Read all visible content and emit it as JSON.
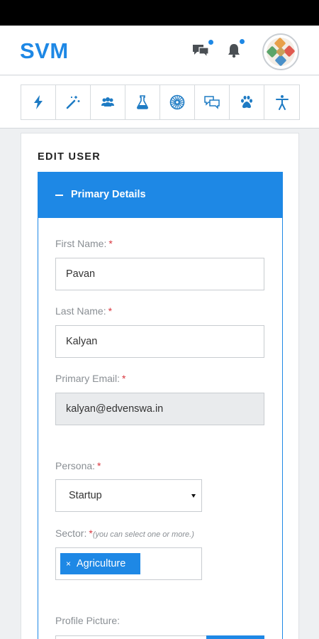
{
  "header": {
    "logo": "SVM"
  },
  "toolbar": {
    "tools": [
      {
        "icon": "lightning-icon"
      },
      {
        "icon": "magic-wand-icon"
      },
      {
        "icon": "users-icon"
      },
      {
        "icon": "flask-icon"
      },
      {
        "icon": "sunburst-icon"
      },
      {
        "icon": "chat-bubbles-icon"
      },
      {
        "icon": "paw-icon"
      },
      {
        "icon": "accessibility-icon"
      }
    ]
  },
  "card": {
    "title": "EDIT USER"
  },
  "panel": {
    "title": "Primary Details"
  },
  "form": {
    "first_name": {
      "label": "First Name:",
      "required": "*",
      "value": "Pavan"
    },
    "last_name": {
      "label": "Last Name:",
      "required": "*",
      "value": "Kalyan"
    },
    "email": {
      "label": "Primary Email:",
      "required": "*",
      "value": "kalyan@edvenswa.in"
    },
    "persona": {
      "label": "Persona:",
      "required": "*",
      "value": "Startup"
    },
    "sector": {
      "label": "Sector:",
      "required": "*",
      "hint": "(you can select one or more.)",
      "tag_remove": "×",
      "selected": [
        "Agriculture"
      ]
    },
    "profile_picture": {
      "label": "Profile Picture:"
    }
  },
  "colors": {
    "accent": "#1e88e5",
    "required": "#d9363e",
    "label": "#8a8f94"
  }
}
